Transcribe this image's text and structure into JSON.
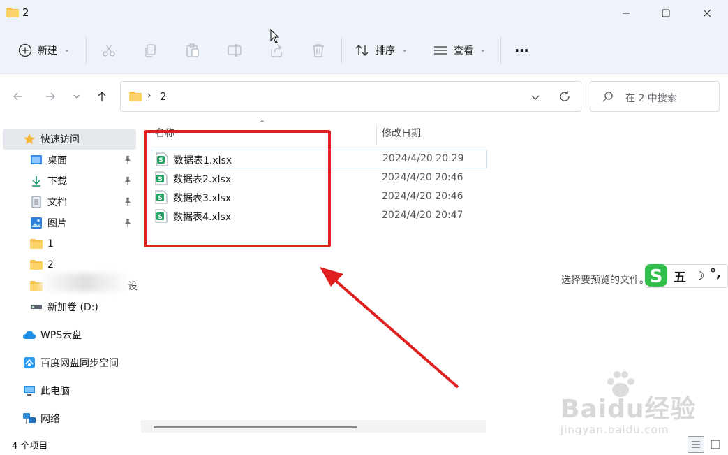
{
  "window": {
    "title": "2",
    "minimize_icon": "minimize-icon",
    "maximize_icon": "maximize-icon",
    "close_icon": "close-icon"
  },
  "toolbar": {
    "new_label": "新建",
    "sort_label": "排序",
    "view_label": "查看",
    "more_label": "···"
  },
  "address": {
    "crumb": "2",
    "search_placeholder": "在 2 中搜索"
  },
  "sidebar": {
    "items": [
      {
        "label": "快速访问",
        "icon": "star-icon"
      },
      {
        "label": "桌面",
        "icon": "desktop-icon",
        "pinned": true
      },
      {
        "label": "下载",
        "icon": "download-icon",
        "pinned": true
      },
      {
        "label": "文档",
        "icon": "document-icon",
        "pinned": true
      },
      {
        "label": "图片",
        "icon": "picture-icon",
        "pinned": true
      },
      {
        "label": "1",
        "icon": "folder-icon"
      },
      {
        "label": "2",
        "icon": "folder-icon"
      },
      {
        "label": "设",
        "icon": "folder-icon"
      },
      {
        "label": "新加卷 (D:)",
        "icon": "drive-icon"
      },
      {
        "label": "WPS云盘",
        "icon": "cloud-icon"
      },
      {
        "label": "百度网盘同步空间",
        "icon": "baidu-netdisk-icon"
      },
      {
        "label": "此电脑",
        "icon": "computer-icon"
      },
      {
        "label": "网络",
        "icon": "network-icon"
      }
    ]
  },
  "files": {
    "col_name": "名称",
    "col_date": "修改日期",
    "rows": [
      {
        "name": "数据表1.xlsx",
        "date": "2024/4/20 20:29"
      },
      {
        "name": "数据表2.xlsx",
        "date": "2024/4/20 20:46"
      },
      {
        "name": "数据表3.xlsx",
        "date": "2024/4/20 20:46"
      },
      {
        "name": "数据表4.xlsx",
        "date": "2024/4/20 20:47"
      }
    ]
  },
  "preview": {
    "text": "选择要预览的文件。"
  },
  "ime": {
    "mode": "五",
    "punct": "°,"
  },
  "status": {
    "count": "4 个项目"
  },
  "watermark": {
    "main": "Baidu经验",
    "sub": "jingyan.baidu.com"
  },
  "colors": {
    "accent_red": "#e02020",
    "chrome_bg": "#eef3f9",
    "excel_green": "#21a366"
  }
}
